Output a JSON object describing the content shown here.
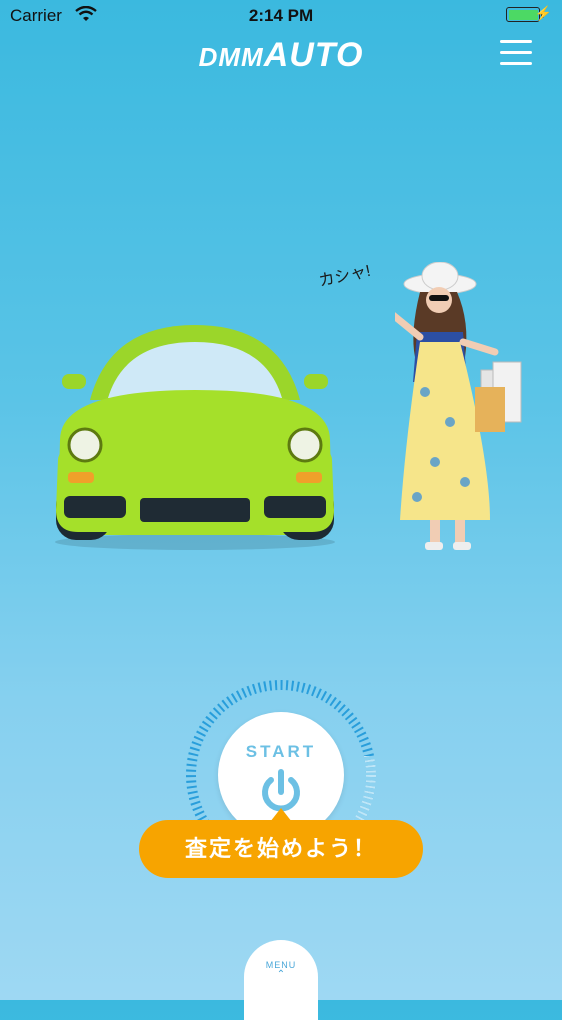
{
  "status_bar": {
    "carrier": "Carrier",
    "time": "2:14 PM"
  },
  "header": {
    "logo_dmm": "DMM",
    "logo_auto": "AUTO"
  },
  "hero": {
    "speech": "カシャ!"
  },
  "start": {
    "label": "START"
  },
  "cta": {
    "label": "査定を始めよう！"
  },
  "bottom": {
    "menu_label": "MENU"
  },
  "colors": {
    "accent": "#f7a400",
    "background_top": "#3bb9df",
    "start_text": "#6cc0e4",
    "car_body": "#a5e02a"
  }
}
